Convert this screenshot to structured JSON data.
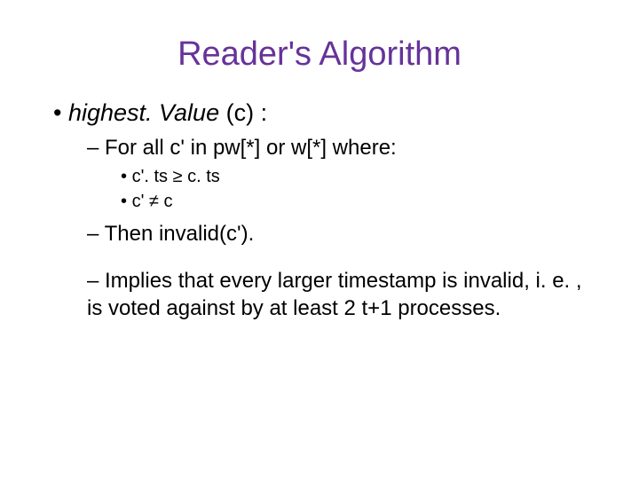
{
  "title": "Reader's Algorithm",
  "b1_italic": "highest. Value",
  "b1_rest": " (c) :",
  "b1_1": "For all c' in pw[*] or w[*] where:",
  "b1_1_1": "c'. ts ≥ c. ts",
  "b1_1_2": "c' ≠ c",
  "b1_2": "Then invalid(c').",
  "b1_3": "Implies that every larger timestamp is invalid, i. e. , is voted against by at least 2 t+1 processes."
}
